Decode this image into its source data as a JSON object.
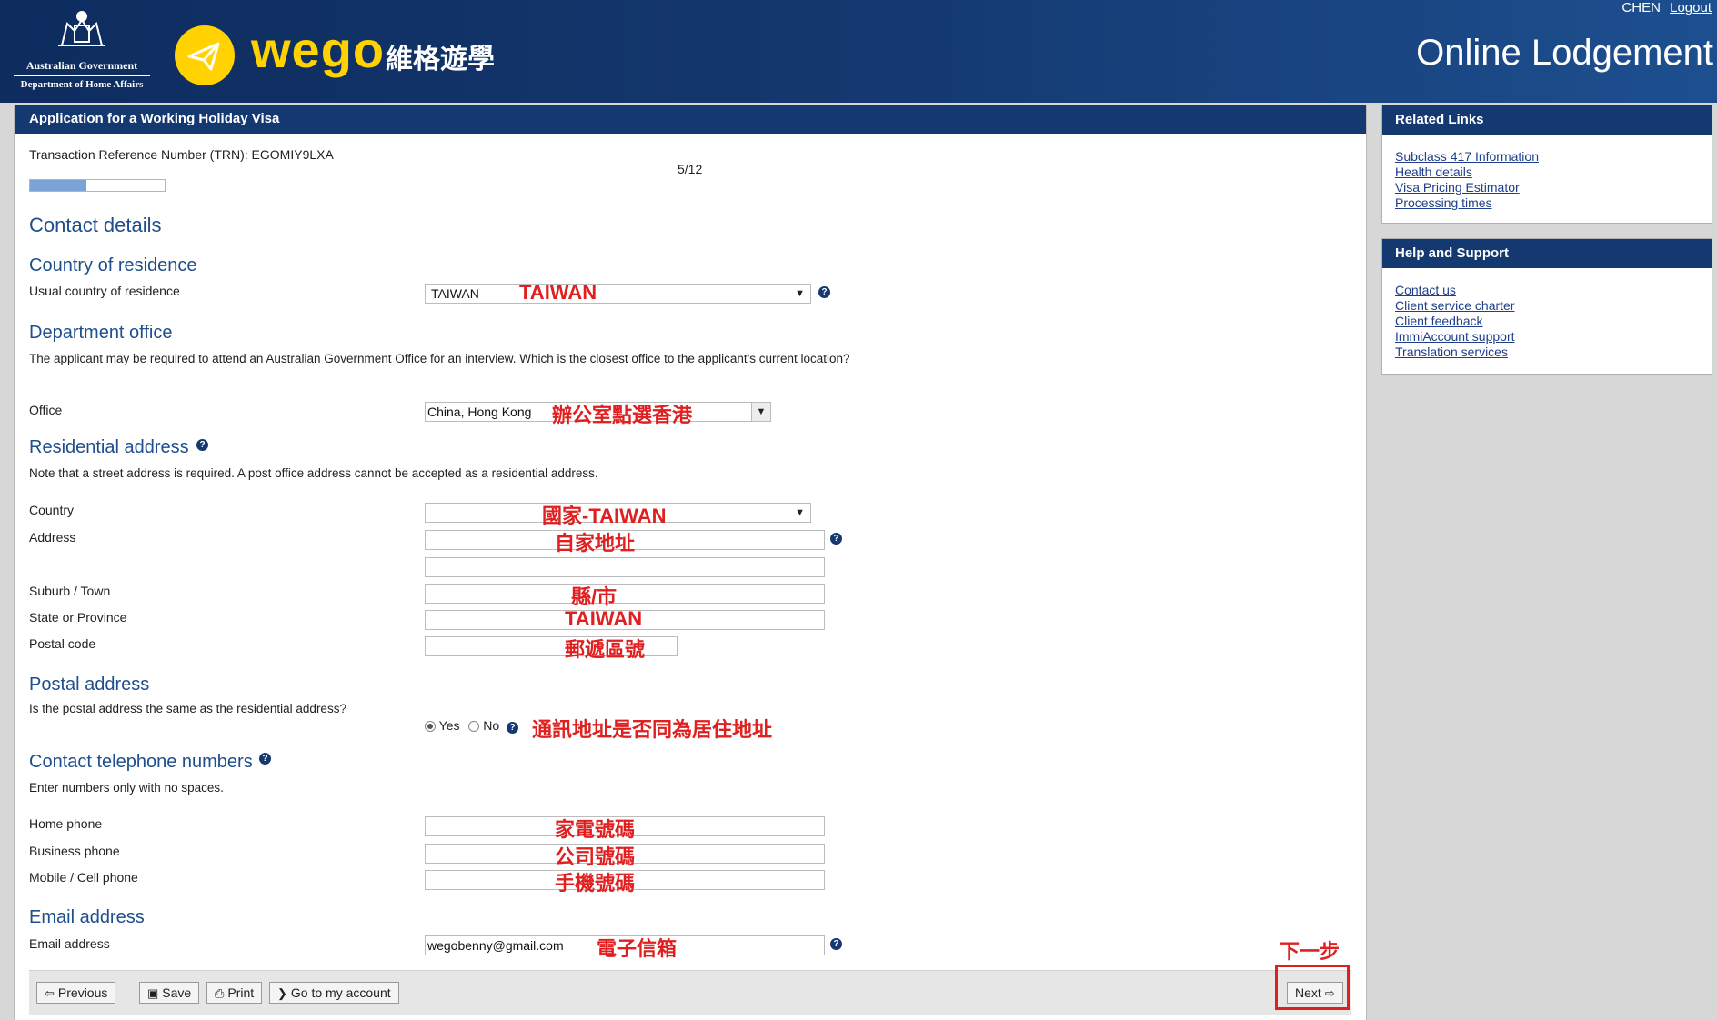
{
  "header": {
    "user_name": "CHEN",
    "logout": "Logout",
    "gov_line1": "Australian Government",
    "gov_line2": "Department of Home Affairs",
    "wego_brand": "wego",
    "wego_cn": "維格遊學",
    "site_title": "Online Lodgement"
  },
  "main": {
    "title": "Application for a Working Holiday Visa",
    "trn_label": "Transaction Reference Number (TRN): EGOMIY9LXA",
    "progress_text": "5/12",
    "progress_fraction": 0.4167,
    "page_heading": "Contact details",
    "country_residence": {
      "heading": "Country of residence",
      "label": "Usual country of residence",
      "value": "TAIWAN",
      "annotation": "TAIWAN"
    },
    "dept_office": {
      "heading": "Department office",
      "note": "The applicant may be required to attend an Australian Government Office for an interview. Which is the closest office to the applicant's current location?",
      "label": "Office",
      "value": "China, Hong Kong",
      "annotation": "辦公室點選香港"
    },
    "residential": {
      "heading": "Residential address",
      "note": "Note that a street address is required. A post office address cannot be accepted as a residential address.",
      "country_label": "Country",
      "country_annotation": "國家-TAIWAN",
      "address_label": "Address",
      "address_annotation": "自家地址",
      "suburb_label": "Suburb / Town",
      "suburb_annotation": "縣/市",
      "state_label": "State or Province",
      "state_annotation": "TAIWAN",
      "postal_label": "Postal code",
      "postal_annotation": "郵遞區號"
    },
    "postal": {
      "heading": "Postal address",
      "question": "Is the postal address the same as the residential address?",
      "yes": "Yes",
      "no": "No",
      "annotation": "通訊地址是否同為居住地址"
    },
    "phones": {
      "heading": "Contact telephone numbers",
      "note": "Enter numbers only with no spaces.",
      "home_label": "Home phone",
      "home_annotation": "家電號碼",
      "business_label": "Business phone",
      "business_annotation": "公司號碼",
      "mobile_label": "Mobile / Cell phone",
      "mobile_annotation": "手機號碼"
    },
    "email": {
      "heading": "Email address",
      "label": "Email address",
      "value": "wegobenny@gmail.com",
      "annotation": "電子信箱"
    },
    "next_annotation": "下一步",
    "buttons": {
      "previous": "Previous",
      "save": "Save",
      "print": "Print",
      "goto": "Go to my account",
      "next": "Next"
    }
  },
  "sidebar": {
    "related": {
      "title": "Related Links",
      "links": [
        "Subclass 417 Information",
        "Health details",
        "Visa Pricing Estimator",
        "Processing times"
      ]
    },
    "help": {
      "title": "Help and Support",
      "links": [
        "Contact us",
        "Client service charter",
        "Client feedback",
        "ImmiAccount support",
        "Translation services"
      ]
    }
  },
  "colors": {
    "navy": "#143870",
    "accent_yellow": "#ffd200",
    "annotation_red": "#e02020",
    "heading_blue": "#1f4e8c"
  }
}
